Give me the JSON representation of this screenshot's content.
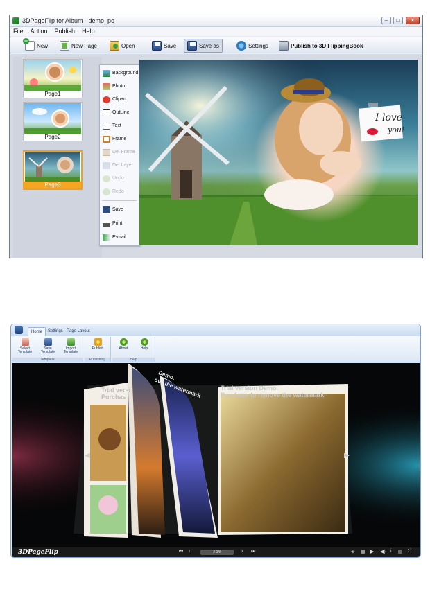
{
  "editor": {
    "title": "3DPageFlip for Album - demo_pc",
    "window_controls": [
      "–",
      "□",
      "✕"
    ],
    "menu": [
      "File",
      "Action",
      "Publish",
      "Help"
    ],
    "toolbar": {
      "new": "New",
      "new_page": "New Page",
      "open": "Open",
      "save": "Save",
      "save_as": "Save as",
      "settings": "Settings",
      "publish": "Publish to 3D FlippingBook"
    },
    "pages": [
      {
        "label": "Page1",
        "selected": false
      },
      {
        "label": "Page2",
        "selected": false
      },
      {
        "label": "Page3",
        "selected": true
      }
    ],
    "side_menu": [
      {
        "label": "Background",
        "icon": "background-icon",
        "enabled": true
      },
      {
        "label": "Photo",
        "icon": "photo-icon",
        "enabled": true
      },
      {
        "label": "Clipart",
        "icon": "clipart-icon",
        "enabled": true
      },
      {
        "label": "OutLine",
        "icon": "outline-icon",
        "enabled": true
      },
      {
        "label": "Text",
        "icon": "text-icon",
        "enabled": true
      },
      {
        "label": "Frame",
        "icon": "frame-icon",
        "enabled": true
      },
      {
        "label": "Del Frame",
        "icon": "del-frame-icon",
        "enabled": false
      },
      {
        "label": "Del Layer",
        "icon": "del-layer-icon",
        "enabled": false
      },
      {
        "label": "Undo",
        "icon": "undo-icon",
        "enabled": false
      },
      {
        "label": "Redo",
        "icon": "redo-icon",
        "enabled": false
      },
      {
        "label": "Save",
        "icon": "save-icon",
        "enabled": true
      },
      {
        "label": "Print",
        "icon": "print-icon",
        "enabled": true
      },
      {
        "label": "E-mail",
        "icon": "email-icon",
        "enabled": true
      }
    ],
    "canvas_note_line1": "I love",
    "canvas_note_line2": "you!"
  },
  "viewer": {
    "tabs": [
      "Home",
      "Settings",
      "Page Layout"
    ],
    "ribbon_groups": [
      {
        "label": "Template",
        "buttons": [
          "Select\nTemplate",
          "Save\nTemplate",
          "Import\nTemplate"
        ]
      },
      {
        "label": "Publishing",
        "buttons": [
          "Publish"
        ]
      },
      {
        "label": "Help",
        "buttons": [
          "About",
          "Help"
        ]
      }
    ],
    "watermark_line1": "Trial version Demo.",
    "watermark_line2": "Purchase to remove the watermark",
    "watermark_left_1": "Trial versi",
    "watermark_left_2": "Purchas",
    "watermark_flip_1": "Demo.",
    "watermark_flip_2": "ove the watermark",
    "brand": "3DPageFlip",
    "page_indicator": "2-3/6"
  },
  "colors": {
    "selected_page": "#f5a623",
    "viewer_bg": "#060708",
    "ribbon_bg": "#dde8f5"
  }
}
